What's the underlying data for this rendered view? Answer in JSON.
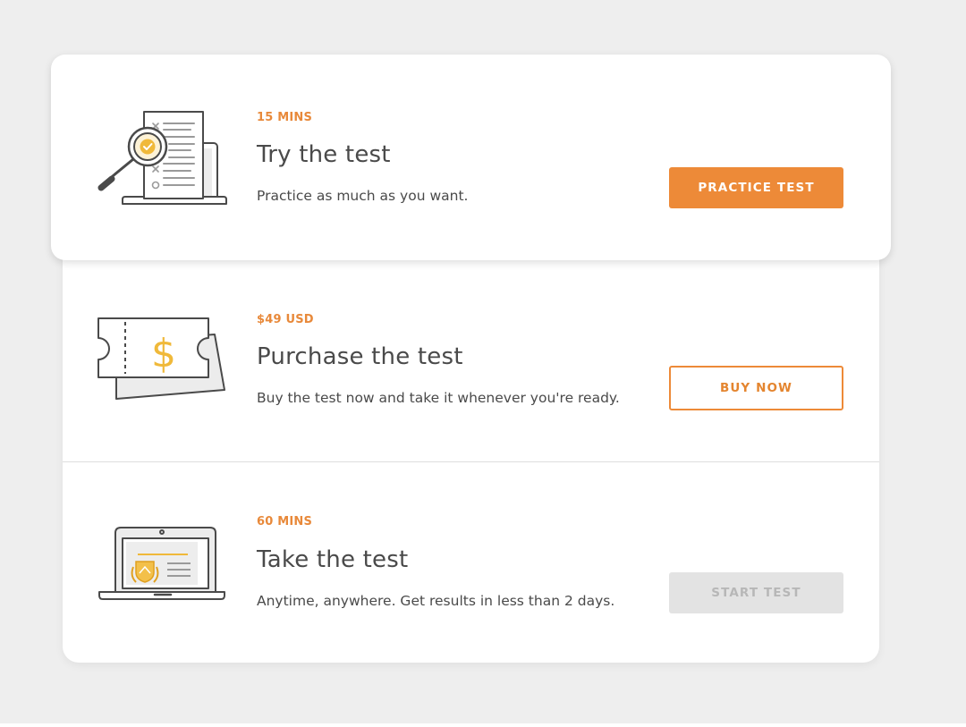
{
  "colors": {
    "accent": "#ed8a38",
    "text": "#4a4a4a",
    "disabled_bg": "#e3e3e3",
    "disabled_text": "#b7b7b7",
    "page_background": "#eeeeee"
  },
  "steps": [
    {
      "meta": "15 MINS",
      "title": "Try the test",
      "description": "Practice as much as you want.",
      "button_label": "PRACTICE TEST",
      "button_state": "primary",
      "icon": "magnifier-document-icon"
    },
    {
      "meta": "$49 USD",
      "title": "Purchase the test",
      "description": "Buy the test now and take it whenever you're ready.",
      "button_label": "BUY NOW",
      "button_state": "outline",
      "icon": "ticket-dollar-icon"
    },
    {
      "meta": "60 MINS",
      "title": "Take the test",
      "description": "Anytime, anywhere. Get results in less than 2 days.",
      "button_label": "START TEST",
      "button_state": "disabled",
      "icon": "laptop-certificate-icon"
    }
  ]
}
